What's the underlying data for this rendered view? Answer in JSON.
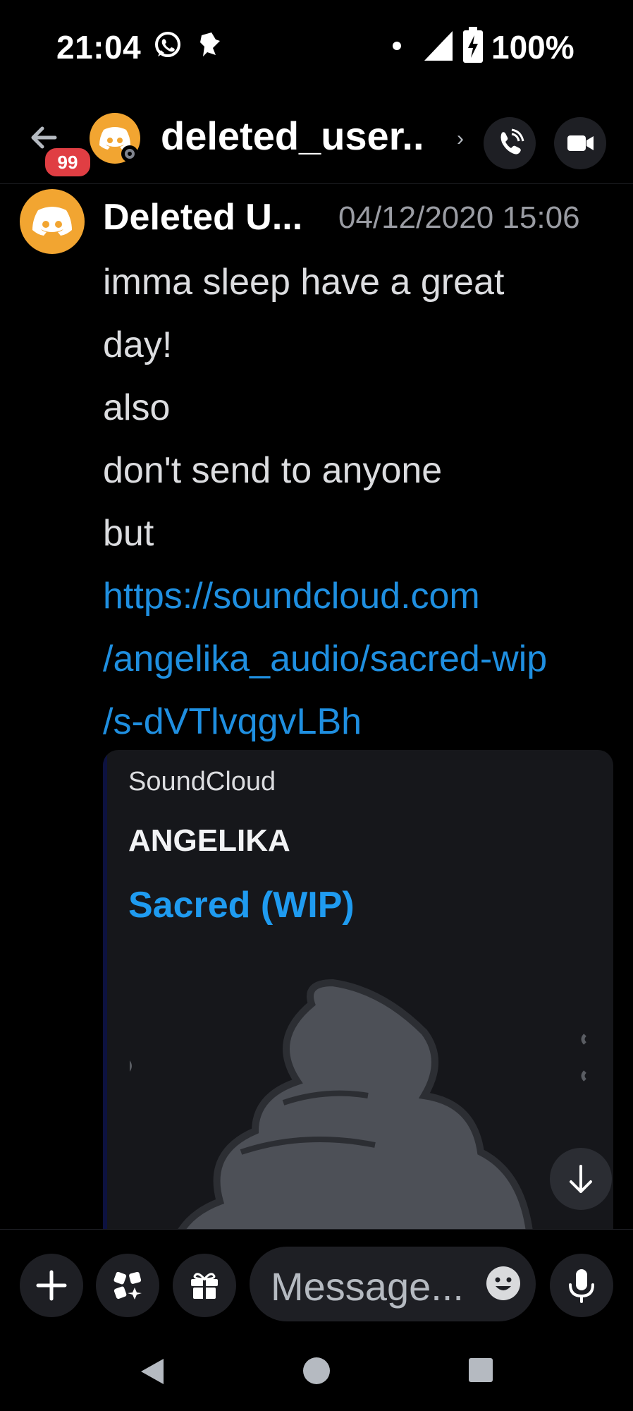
{
  "status_bar": {
    "time": "21:04",
    "battery": "100%",
    "icons": [
      "whatsapp-icon",
      "notification-icon",
      "dot-icon",
      "signal-icon",
      "battery-charging-icon"
    ]
  },
  "header": {
    "badge_count": "99",
    "title": "deleted_user..",
    "chevron": "›",
    "icons": [
      "back-arrow-icon",
      "phone-call-icon",
      "video-call-icon"
    ]
  },
  "message": {
    "author": "Deleted U...",
    "timestamp": "04/12/2020 15:06",
    "lines": [
      "imma sleep have a great",
      "day!",
      "also",
      "don't send to anyone",
      "but"
    ],
    "link_lines": [
      "https://soundcloud.com",
      "/angelika_audio/sacred-wip",
      "/s-dVTlvqgvLBh"
    ]
  },
  "embed": {
    "provider": "SoundCloud",
    "author": "ANGELIKA",
    "title": "Sacred (WIP)"
  },
  "composer": {
    "placeholder": "Message...",
    "icons": [
      "plus-icon",
      "apps-icon",
      "gift-icon",
      "emoji-icon",
      "microphone-icon"
    ]
  },
  "colors": {
    "background": "#000000",
    "avatar": "#f2a531",
    "link": "#1f8fe0",
    "badge": "#e03e43",
    "embed_bg": "#16171b"
  }
}
